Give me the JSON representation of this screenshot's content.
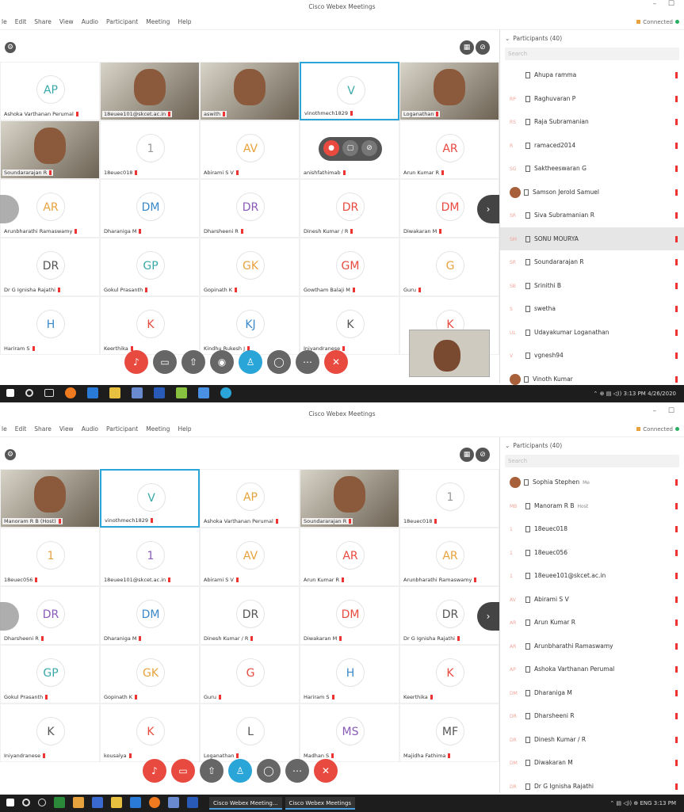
{
  "window": {
    "title": "Cisco Webex Meetings",
    "connected": "Connected"
  },
  "menu": [
    "le",
    "Edit",
    "Share",
    "View",
    "Audio",
    "Participant",
    "Meeting",
    "Help"
  ],
  "shot1": {
    "participants_header": "Participants (40)",
    "search_placeholder": "Search",
    "grid": [
      {
        "initials": "AP",
        "name": "Ashoka Varthanan Perumal",
        "initial_color": "#3aa8a8"
      },
      {
        "video": true,
        "name": "18euee101@skcet.ac.in"
      },
      {
        "video": true,
        "name": "aswith"
      },
      {
        "initials": "V",
        "name": "vinothmech1829",
        "initial_color": "#3aa8a8",
        "selected": true
      },
      {
        "video": true,
        "name": "Loganathan"
      },
      {
        "video": true,
        "name": "Soundararajan R"
      },
      {
        "initials": "1",
        "name": "18euec018",
        "initial_color": "#999999"
      },
      {
        "initials": "AV",
        "name": "Abirami S V",
        "initial_color": "#e8a23d"
      },
      {
        "initials": "",
        "name": "anishfathimab"
      },
      {
        "initials": "AR",
        "name": "Arun Kumar R",
        "initial_color": "#e84a3f"
      },
      {
        "initials": "AR",
        "name": "Arunbharathi Ramaswamy",
        "initial_color": "#e8a23d"
      },
      {
        "initials": "DM",
        "name": "Dharaniga M",
        "initial_color": "#3a88c8"
      },
      {
        "initials": "DR",
        "name": "Dharsheeni R",
        "initial_color": "#8a5ab8"
      },
      {
        "initials": "DR",
        "name": "Dinesh Kumar / R",
        "initial_color": "#e84a3f"
      },
      {
        "initials": "DM",
        "name": "Diwakaran M",
        "initial_color": "#e84a3f"
      },
      {
        "initials": "DR",
        "name": "Dr G Ignisha Rajathi",
        "initial_color": "#555555"
      },
      {
        "initials": "GP",
        "name": "Gokul Prasanth",
        "initial_color": "#3aa8a8"
      },
      {
        "initials": "GK",
        "name": "Gopinath K",
        "initial_color": "#e8a23d"
      },
      {
        "initials": "GM",
        "name": "Gowtham Balaji M",
        "initial_color": "#e84a3f"
      },
      {
        "initials": "G",
        "name": "Guru",
        "initial_color": "#e8a23d"
      },
      {
        "initials": "H",
        "name": "Hariram S",
        "initial_color": "#3a88c8"
      },
      {
        "initials": "K",
        "name": "Keerthika",
        "initial_color": "#e84a3f"
      },
      {
        "initials": "KJ",
        "name": "Kindhu Rukesh J",
        "initial_color": "#3a88c8"
      },
      {
        "initials": "K",
        "name": "Iniyandranese",
        "initial_color": "#555555"
      },
      {
        "initials": "K",
        "name": "",
        "initial_color": "#e84a3f"
      }
    ],
    "participants": [
      {
        "initials": "",
        "name": "Ahupa ramma"
      },
      {
        "initials": "RP",
        "name": "Raghuvaran P"
      },
      {
        "initials": "RS",
        "name": "Raja Subramanian"
      },
      {
        "initials": "R",
        "name": "ramaced2014"
      },
      {
        "initials": "SG",
        "name": "Saktheeswaran G"
      },
      {
        "initials": "",
        "name": "Samson Jerold Samuel",
        "photo": true
      },
      {
        "initials": "SR",
        "name": "Siva Subramanian R"
      },
      {
        "initials": "SM",
        "name": "SONU MOURYA",
        "highlight": true
      },
      {
        "initials": "SR",
        "name": "Soundararajan R"
      },
      {
        "initials": "SB",
        "name": "Srinithi B"
      },
      {
        "initials": "S",
        "name": "swetha"
      },
      {
        "initials": "UL",
        "name": "Udayakumar Loganathan"
      },
      {
        "initials": "V",
        "name": "vgnesh94"
      },
      {
        "initials": "",
        "name": "Vinoth Kumar",
        "photo": true
      }
    ],
    "clock": {
      "time": "3:13 PM",
      "date": "4/26/2020"
    }
  },
  "shot2": {
    "participants_header": "Participants (40)",
    "search_placeholder": "Search",
    "grid": [
      {
        "video": true,
        "name": "Manoram R B (Host)"
      },
      {
        "initials": "V",
        "name": "vinothmech1829",
        "initial_color": "#3aa8a8",
        "selected": true
      },
      {
        "initials": "AP",
        "name": "Ashoka Varthanan Perumal",
        "initial_color": "#e8a23d"
      },
      {
        "video": true,
        "name": "Soundararajan R"
      },
      {
        "initials": "1",
        "name": "18euec018",
        "initial_color": "#999999"
      },
      {
        "initials": "1",
        "name": "18euec056",
        "initial_color": "#e8a23d"
      },
      {
        "initials": "1",
        "name": "18euee101@skcet.ac.in",
        "initial_color": "#8a5ab8"
      },
      {
        "initials": "AV",
        "name": "Abirami S V",
        "initial_color": "#e8a23d"
      },
      {
        "initials": "AR",
        "name": "Arun Kumar R",
        "initial_color": "#e84a3f"
      },
      {
        "initials": "AR",
        "name": "Arunbharathi Ramaswamy",
        "initial_color": "#e8a23d"
      },
      {
        "initials": "DR",
        "name": "Dharsheeni R",
        "initial_color": "#8a5ab8"
      },
      {
        "initials": "DM",
        "name": "Dharaniga M",
        "initial_color": "#3a88c8"
      },
      {
        "initials": "DR",
        "name": "Dinesh Kumar / R",
        "initial_color": "#555555"
      },
      {
        "initials": "DM",
        "name": "Diwakaran M",
        "initial_color": "#e84a3f"
      },
      {
        "initials": "DR",
        "name": "Dr G Ignisha Rajathi",
        "initial_color": "#555555"
      },
      {
        "initials": "GP",
        "name": "Gokul Prasanth",
        "initial_color": "#3aa8a8"
      },
      {
        "initials": "GK",
        "name": "Gopinath K",
        "initial_color": "#e8a23d"
      },
      {
        "initials": "G",
        "name": "Guru",
        "initial_color": "#e84a3f"
      },
      {
        "initials": "H",
        "name": "Hariram S",
        "initial_color": "#3a88c8"
      },
      {
        "initials": "K",
        "name": "Keerthika",
        "initial_color": "#e84a3f"
      },
      {
        "initials": "K",
        "name": "Iniyandranese",
        "initial_color": "#555555"
      },
      {
        "initials": "K",
        "name": "kousalya",
        "initial_color": "#e84a3f"
      },
      {
        "initials": "L",
        "name": "Loganathan",
        "initial_color": "#555555"
      },
      {
        "initials": "MS",
        "name": "Madhan S",
        "initial_color": "#8a5ab8"
      },
      {
        "initials": "MF",
        "name": "Majidha Fathima",
        "initial_color": "#555555"
      }
    ],
    "participants": [
      {
        "initials": "",
        "name": "Sophia Stephen",
        "sub": "Me",
        "photo": true
      },
      {
        "initials": "MB",
        "name": "Manoram R B",
        "sub": "Host"
      },
      {
        "initials": "1",
        "name": "18euec018"
      },
      {
        "initials": "1",
        "name": "18euec056"
      },
      {
        "initials": "1",
        "name": "18euee101@skcet.ac.in"
      },
      {
        "initials": "AV",
        "name": "Abirami S V"
      },
      {
        "initials": "AR",
        "name": "Arun Kumar R"
      },
      {
        "initials": "AR",
        "name": "Arunbharathi Ramaswamy"
      },
      {
        "initials": "AP",
        "name": "Ashoka Varthanan Perumal"
      },
      {
        "initials": "DM",
        "name": "Dharaniga M"
      },
      {
        "initials": "DR",
        "name": "Dharsheeni R"
      },
      {
        "initials": "DR",
        "name": "Dinesh Kumar / R"
      },
      {
        "initials": "DM",
        "name": "Diwakaran M"
      },
      {
        "initials": "DR",
        "name": "Dr G Ignisha Rajathi"
      }
    ],
    "taskbar_items": [
      "Cisco Webex Meeting...",
      "Cisco Webex Meetings"
    ],
    "clock": {
      "time": "3:13 PM",
      "lang": "ENG"
    }
  }
}
